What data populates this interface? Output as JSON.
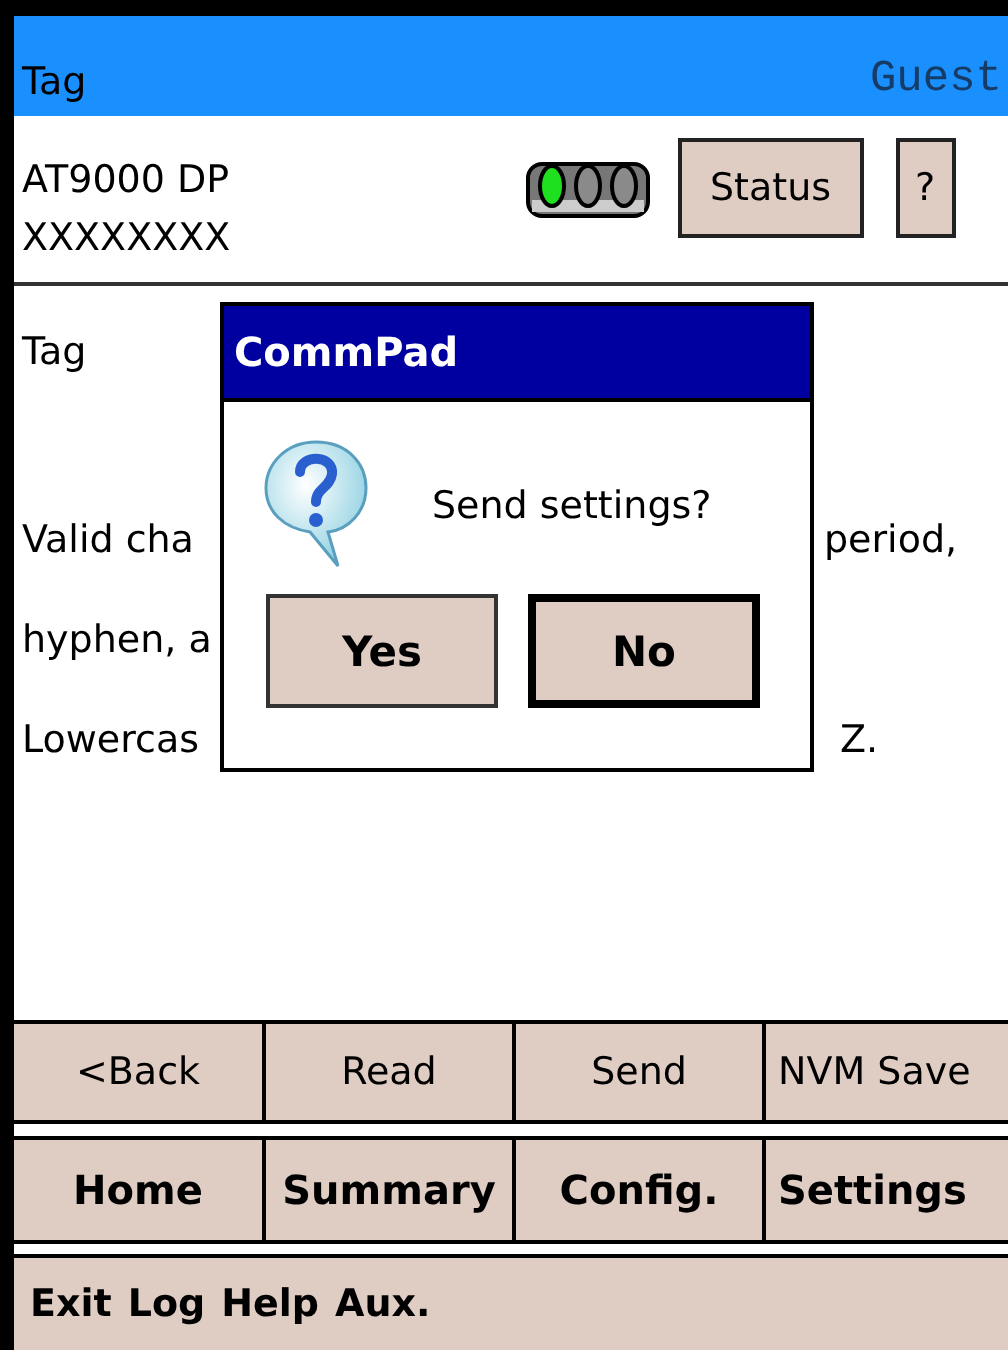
{
  "header": {
    "title": "Tag",
    "user": "Guest"
  },
  "device": {
    "model": "AT9000 DP",
    "serial": "XXXXXXXX",
    "lights": [
      {
        "on": true
      },
      {
        "on": false
      },
      {
        "on": false
      }
    ],
    "buttons": [
      "Status",
      "?"
    ]
  },
  "content": {
    "label": "Tag",
    "lines": [
      {
        "left": "Valid cha",
        "right": "period,"
      },
      {
        "left": "hyphen, a"
      },
      {
        "left": "Lowercas",
        "right": "Z."
      }
    ]
  },
  "dialog": {
    "title": "CommPad",
    "message": "Send settings?",
    "buttons": [
      {
        "label": "Yes",
        "selected": false
      },
      {
        "label": "No",
        "selected": true
      }
    ]
  },
  "actions": [
    "<Back",
    "Read",
    "Send",
    "NVM Save"
  ],
  "nav": [
    "Home",
    "Summary",
    "Config.",
    "Settings"
  ],
  "menu": [
    "Exit",
    "Log",
    "Help",
    "Aux."
  ]
}
